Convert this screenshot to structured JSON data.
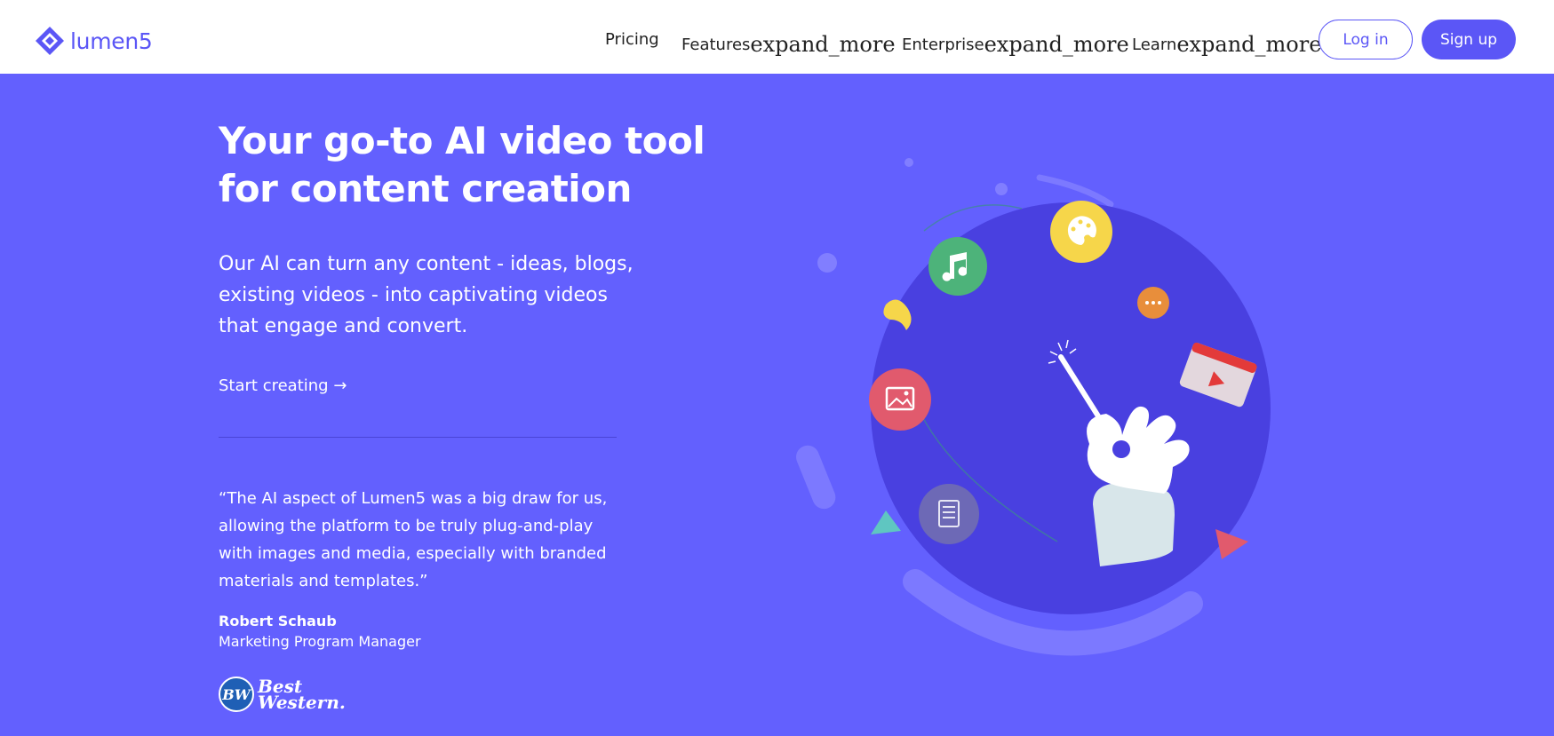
{
  "brand": {
    "name": "lumen5",
    "color": "#5b56f6"
  },
  "nav": {
    "items": [
      {
        "label": "Pricing",
        "icon_text": ""
      },
      {
        "label": "Features",
        "icon_text": "expand_more"
      },
      {
        "label": "Enterprise",
        "icon_text": "expand_more"
      },
      {
        "label": "Learn",
        "icon_text": "expand_more"
      }
    ],
    "login_label": "Log in",
    "signup_label": "Sign up"
  },
  "hero": {
    "title": "Your go-to AI video tool for content creation",
    "subtitle": "Our AI can turn any content - ideas, blogs, existing videos - into captivating videos that engage and convert.",
    "cta_label": "Start creating →",
    "background": "#6360fe"
  },
  "testimonial": {
    "quote": "“The AI aspect of Lumen5 was a big draw for us, allowing the platform to be truly plug-and-play with images and media, especially with branded materials and templates.”",
    "author": "Robert Schaub",
    "role": "Marketing Program Manager",
    "company_badge": "BW",
    "company_line1": "Best",
    "company_line2": "Western."
  }
}
